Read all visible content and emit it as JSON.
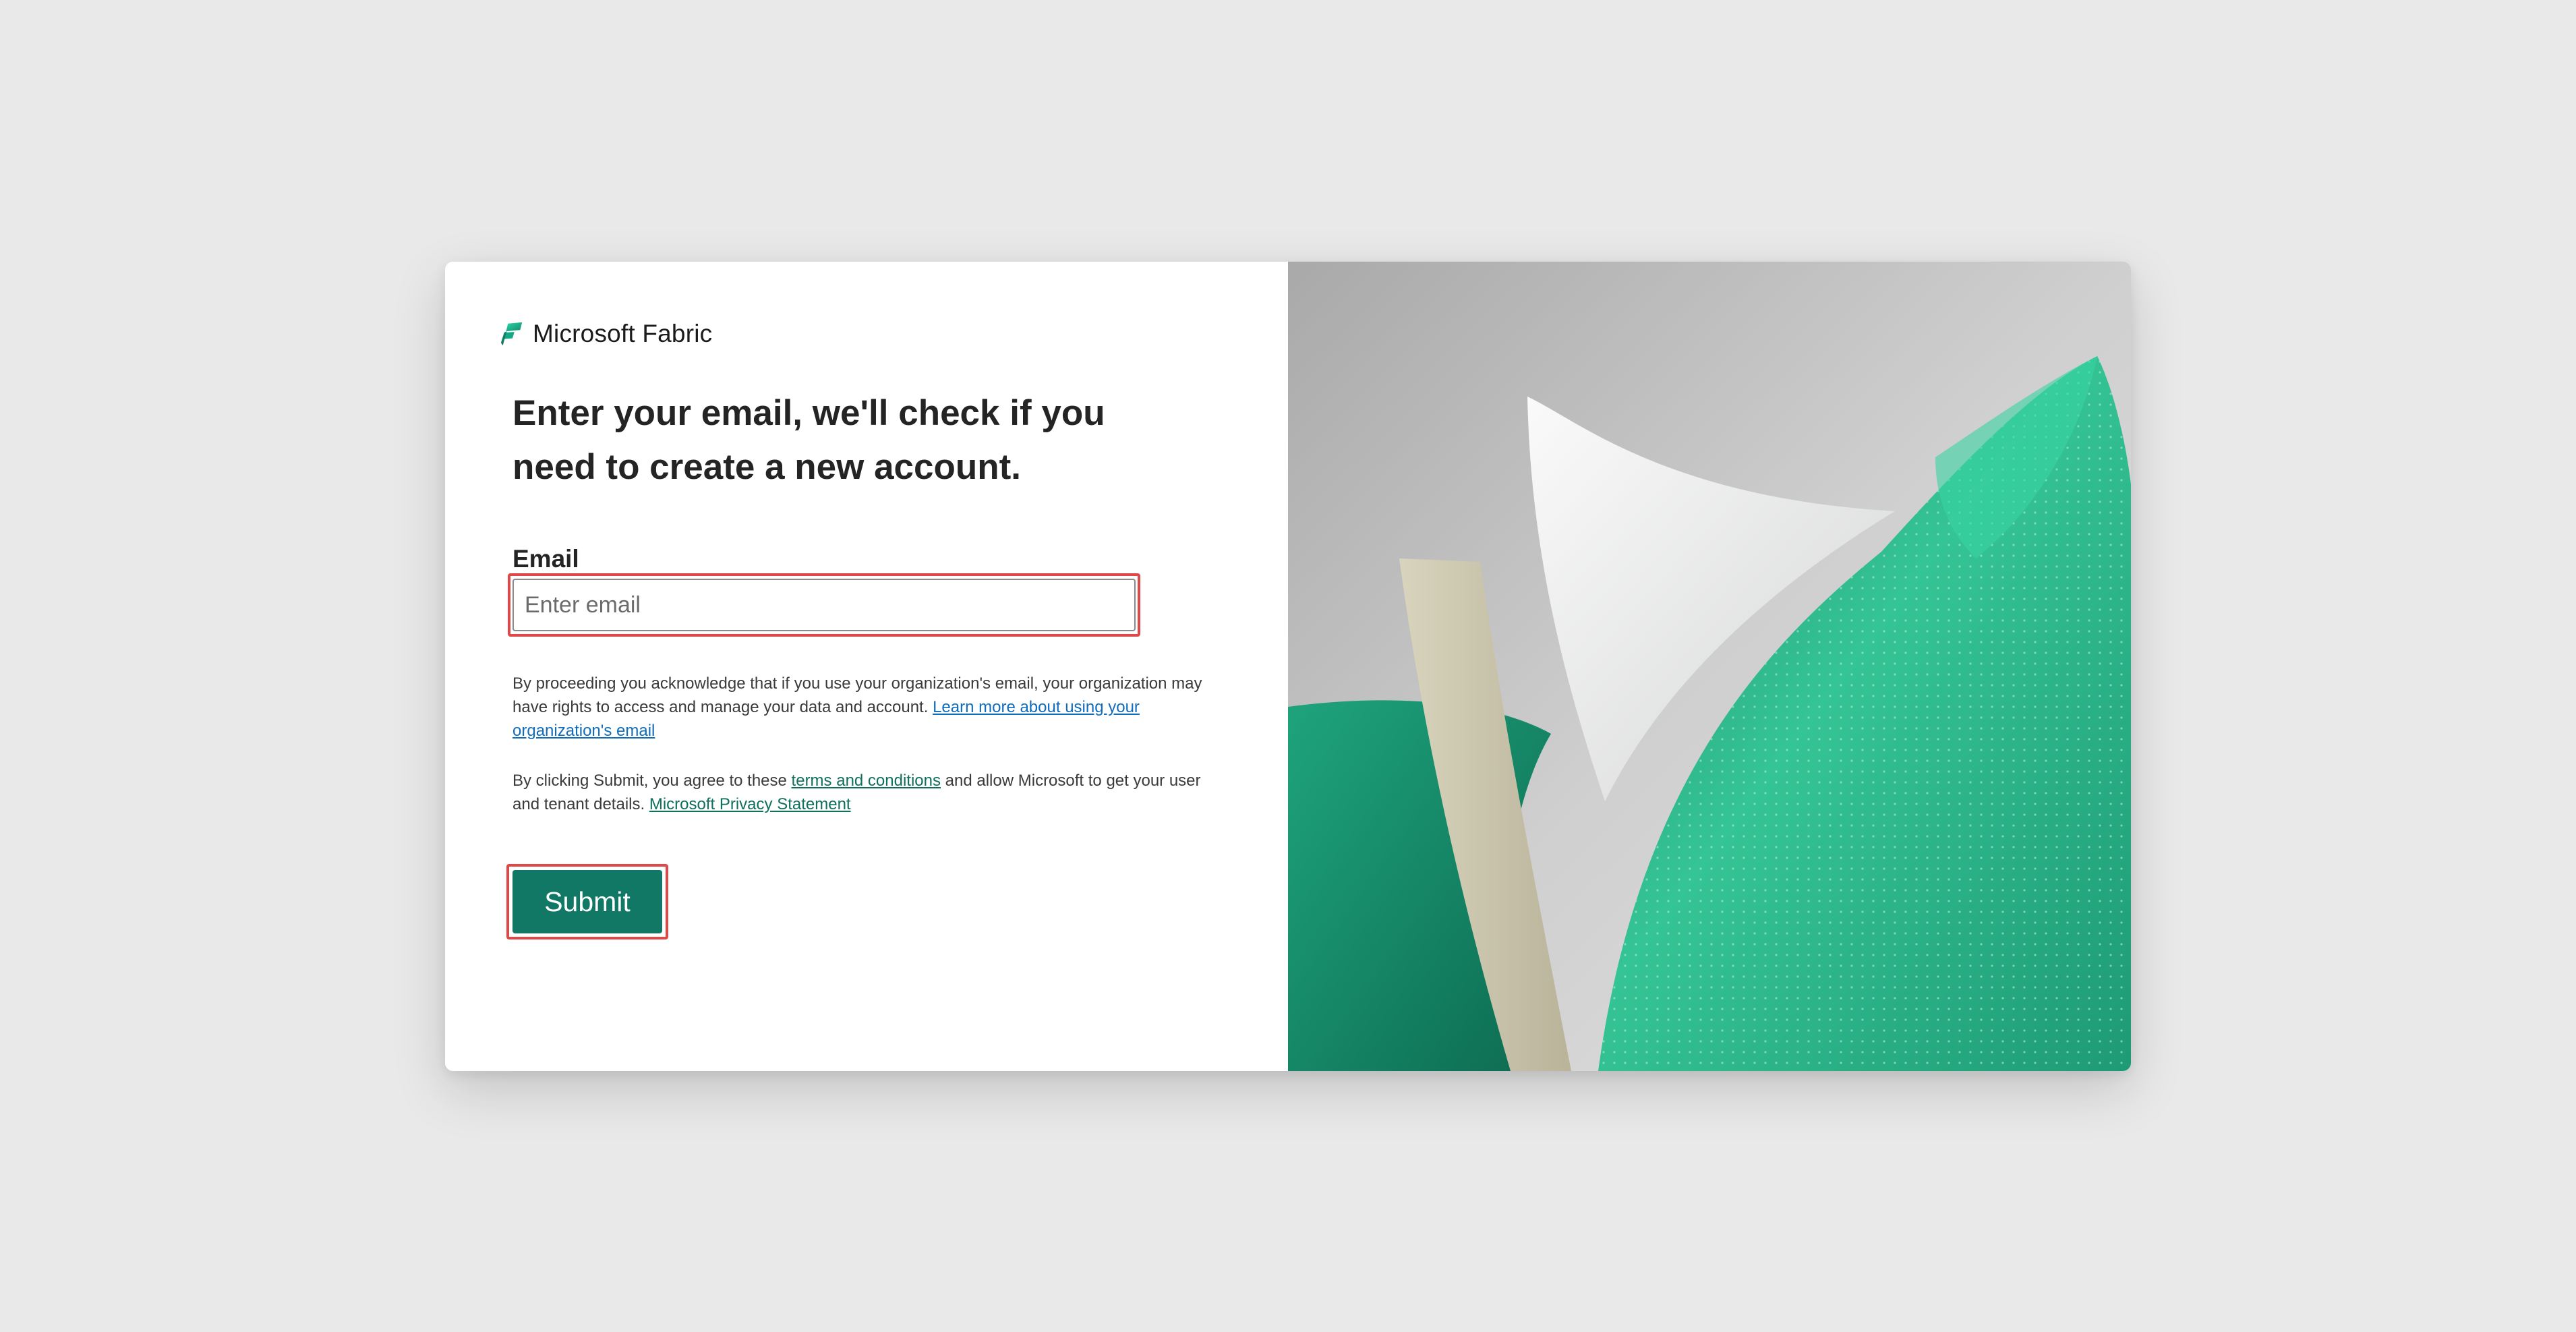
{
  "brand": {
    "name": "Microsoft Fabric",
    "logo_icon": "microsoft-fabric-logo-icon"
  },
  "form": {
    "headline": "Enter your email, we'll check if you need to create a new account.",
    "email_label": "Email",
    "email_placeholder": "Enter email",
    "email_value": "",
    "submit_label": "Submit"
  },
  "legal": {
    "notice_text": "By proceeding you acknowledge that if you use your organization's email, your organization may have rights to access and manage your data and account. ",
    "notice_link": "Learn more about using your organization's email",
    "terms_prefix": "By clicking Submit, you agree to these ",
    "terms_link": "terms and conditions",
    "terms_middle": " and allow Microsoft to get your user and tenant details. ",
    "privacy_link": "Microsoft Privacy Statement"
  },
  "colors": {
    "page_background": "#e9e9e9",
    "card_background": "#ffffff",
    "primary_green": "#117865",
    "link_blue": "#0f6cbd",
    "link_green": "#0e6f5c",
    "highlight_red": "#e04848"
  }
}
